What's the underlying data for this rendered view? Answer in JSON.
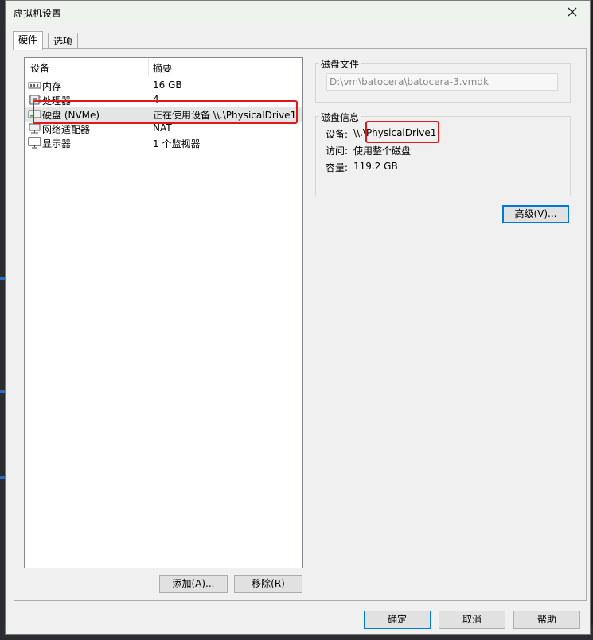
{
  "window": {
    "title": "虚拟机设置",
    "close_icon": "close-icon"
  },
  "tabs": [
    {
      "label": "硬件",
      "active": true
    },
    {
      "label": "选项",
      "active": false
    }
  ],
  "device_list": {
    "headers": {
      "device": "设备",
      "summary": "摘要"
    },
    "items": [
      {
        "icon": "memory-icon",
        "name": "内存",
        "summary": "16 GB",
        "selected": false
      },
      {
        "icon": "processor-icon",
        "name": "处理器",
        "summary": "4",
        "selected": false
      },
      {
        "icon": "hard-disk-icon",
        "name": "硬盘 (NVMe)",
        "summary": "正在使用设备 \\\\.\\PhysicalDrive1",
        "selected": true
      },
      {
        "icon": "network-adapter-icon",
        "name": "网络适配器",
        "summary": "NAT",
        "selected": false
      },
      {
        "icon": "display-icon",
        "name": "显示器",
        "summary": "1 个监视器",
        "selected": false
      }
    ]
  },
  "disk_file": {
    "label": "磁盘文件",
    "value": "D:\\vm\\batocera\\batocera-3.vmdk"
  },
  "disk_info": {
    "label": "磁盘信息",
    "device_label": "设备:",
    "device_value": "\\\\.\\PhysicalDrive1",
    "access_label": "访问:",
    "access_value": "使用整个磁盘",
    "capacity_label": "容量:",
    "capacity_value": "119.2 GB"
  },
  "buttons": {
    "advanced": "高级(V)...",
    "add": "添加(A)...",
    "remove": "移除(R)",
    "ok": "确定",
    "cancel": "取消",
    "help": "帮助"
  },
  "colors": {
    "highlight": "#e0181c",
    "focus": "#0078d7"
  }
}
